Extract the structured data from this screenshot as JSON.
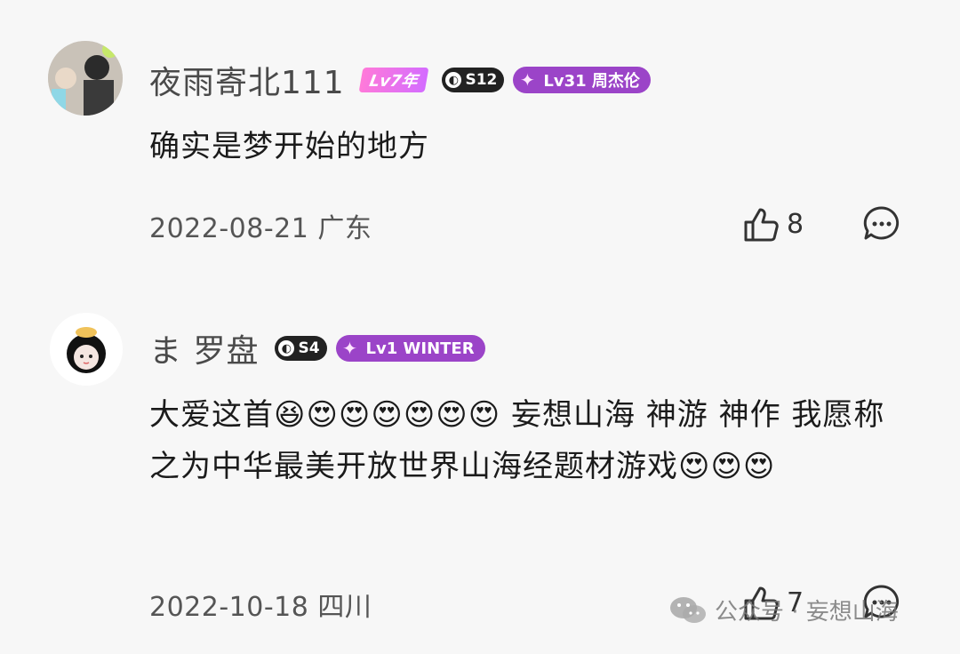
{
  "comments": [
    {
      "username": "夜雨寄北111",
      "badges": {
        "year": "Lv7年",
        "season": "S12",
        "level": "Lv31 周杰伦"
      },
      "text": "确实是梦开始的地方",
      "date_location": "2022-08-21 广东",
      "likes": "8"
    },
    {
      "username": "ま 罗盘",
      "badges": {
        "season": "S4",
        "level": "Lv1 WINTER"
      },
      "text_part1": "大爱这首",
      "text_part2": " 妄想山海  神游 神作     我愿称之为中华最美开放世界山海经题材游戏",
      "date_location": "2022-10-18 四川",
      "likes": "7"
    }
  ],
  "watermark": "公众号 · 妄想山海",
  "icons": {
    "like": "thumbs-up-icon",
    "reply": "comment-bubble-icon",
    "wechat": "wechat-logo-icon",
    "emoji_grin": "😆",
    "emoji_heart_eyes": "😍"
  },
  "colors": {
    "level_badge": "#9b44c8",
    "year_badge": "#e070e8",
    "season_badge": "#222222"
  }
}
